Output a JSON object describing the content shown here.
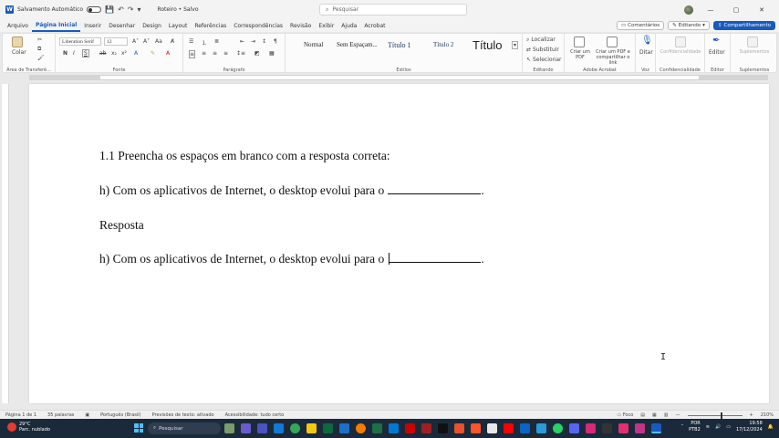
{
  "titlebar": {
    "autosave_label": "Salvamento Automático",
    "doc_title": "Roteiro • Salvo",
    "search_placeholder": "Pesquisar",
    "minimize": "—",
    "maximize": "▢",
    "close": "✕"
  },
  "menu": {
    "tabs": [
      "Arquivo",
      "Página Inicial",
      "Inserir",
      "Desenhar",
      "Design",
      "Layout",
      "Referências",
      "Correspondências",
      "Revisão",
      "Exibir",
      "Ajuda",
      "Acrobat"
    ],
    "active_index": 1,
    "comments": "Comentários",
    "editing": "Editando",
    "share": "Compartilhamento"
  },
  "ribbon": {
    "clipboard_label": "Área de Transferê...",
    "paste": "Colar",
    "font_name": "Liberation Serif",
    "font_size": "12",
    "font_label": "Fonte",
    "bold": "N",
    "italic": "I",
    "underline": "S",
    "paragraph_label": "Parágrafo",
    "styles": [
      "Normal",
      "Sem Espaçam...",
      "Título 1",
      "Título 2",
      "Título"
    ],
    "styles_label": "Estilos",
    "find": "Localizar",
    "replace": "Substituir",
    "select": "Selecionar",
    "editing_label": "Editando",
    "create_pdf": "Criar um PDF",
    "create_share_pdf": "Criar um PDF e compartilhar o link",
    "adobe_label": "Adobe Acrobat",
    "dictate": "Ditar",
    "voice_label": "Voz",
    "sensitivity": "Confidencialidade",
    "sensitivity_label": "Confidencialidade",
    "editor": "Editor",
    "editor_label": "Editor",
    "addins": "Suplementos",
    "addins_label": "Suplementos"
  },
  "document": {
    "line1": "1.1 Preencha os espaços em branco com a resposta correta:",
    "line2": "h) Com os aplicativos de Internet, o desktop evolui para o",
    "line2_end": ".",
    "line3": "Resposta",
    "line4": "h) Com os aplicativos de Internet, o desktop evolui para o",
    "line4_end": "."
  },
  "statusbar": {
    "page": "Página 1 de 1",
    "words": "35 palavras",
    "language": "Português (Brasil)",
    "predictions": "Previsões de texto: ativado",
    "accessibility": "Acessibilidade: tudo certo",
    "focus": "Foco",
    "zoom": "210%"
  },
  "taskbar": {
    "weather_temp": "29°C",
    "weather_desc": "Parc. nublado",
    "search": "Pesquisar",
    "lang1": "POR",
    "lang2": "PTB2",
    "time": "19:58",
    "date": "17/12/2024"
  }
}
